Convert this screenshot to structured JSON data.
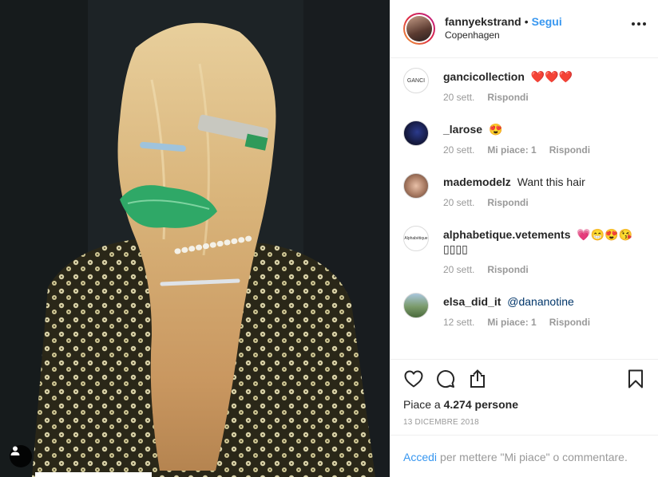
{
  "post": {
    "author": "fannyekstrand",
    "separator": "•",
    "follow_label": "Segui",
    "location": "Copenhagen",
    "more_icon": "more-horizontal-icon"
  },
  "comments": [
    {
      "username": "gancicollection",
      "text": "❤️❤️❤️",
      "avatar_text": "GANCI",
      "time": "20 sett.",
      "likes": "",
      "reply": "Rispondi"
    },
    {
      "username": "_larose",
      "text": "😍",
      "avatar_text": "",
      "time": "20 sett.",
      "likes": "Mi piace: 1",
      "reply": "Rispondi"
    },
    {
      "username": "mademodelz",
      "text": "Want this hair",
      "avatar_text": "",
      "time": "20 sett.",
      "likes": "",
      "reply": "Rispondi"
    },
    {
      "username": "alphabetique.vetements",
      "text": "💗😁😍😘 ▯▯▯▯",
      "avatar_text": "Alphabétique",
      "time": "20 sett.",
      "likes": "",
      "reply": "Rispondi"
    },
    {
      "username": "elsa_did_it",
      "text": "@dananotine",
      "avatar_text": "",
      "time": "12 sett.",
      "likes": "Mi piace: 1",
      "reply": "Rispondi"
    }
  ],
  "actions": {
    "like_icon": "heart-icon",
    "comment_icon": "comment-icon",
    "share_icon": "share-icon",
    "save_icon": "bookmark-icon"
  },
  "likes": {
    "prefix": "Piace a ",
    "count": "4.274 persone"
  },
  "date": "13 DICEMBRE 2018",
  "footer": {
    "login_label": "Accedi",
    "rest": "per mettere \"Mi piace\" o commentare."
  },
  "colors": {
    "accent": "#3897f0",
    "muted": "#999999",
    "text": "#262626"
  }
}
